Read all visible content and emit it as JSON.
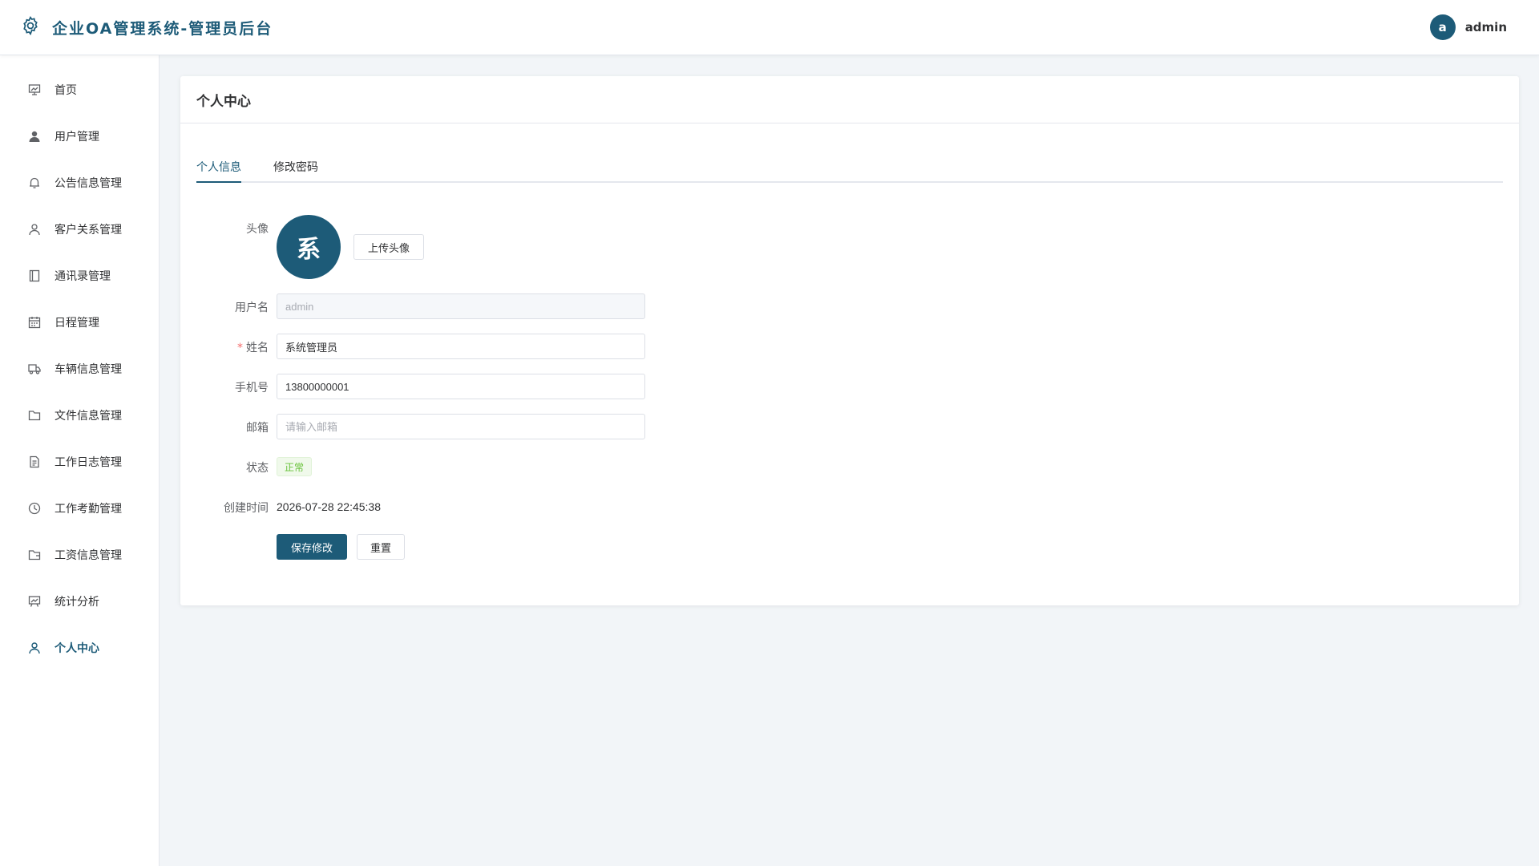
{
  "header": {
    "title": "企业OA管理系统-管理员后台",
    "user_avatar_letter": "a",
    "user_name": "admin"
  },
  "sidebar": {
    "items": [
      {
        "label": "首页",
        "icon": "dashboard-icon"
      },
      {
        "label": "用户管理",
        "icon": "user-filled-icon"
      },
      {
        "label": "公告信息管理",
        "icon": "bell-icon"
      },
      {
        "label": "客户关系管理",
        "icon": "user-icon"
      },
      {
        "label": "通讯录管理",
        "icon": "notebook-icon"
      },
      {
        "label": "日程管理",
        "icon": "calendar-icon"
      },
      {
        "label": "车辆信息管理",
        "icon": "truck-icon"
      },
      {
        "label": "文件信息管理",
        "icon": "folder-icon"
      },
      {
        "label": "工作日志管理",
        "icon": "document-icon"
      },
      {
        "label": "工作考勤管理",
        "icon": "clock-icon"
      },
      {
        "label": "工资信息管理",
        "icon": "wallet-folder-icon"
      },
      {
        "label": "统计分析",
        "icon": "chart-board-icon"
      },
      {
        "label": "个人中心",
        "icon": "user-icon",
        "active": true
      }
    ]
  },
  "card": {
    "title": "个人中心",
    "tabs": [
      {
        "label": "个人信息",
        "active": true
      },
      {
        "label": "修改密码",
        "active": false
      }
    ]
  },
  "form": {
    "avatar_label": "头像",
    "avatar_char": "系",
    "upload_button": "上传头像",
    "username_label": "用户名",
    "username_value": "admin",
    "required_mark": "*",
    "name_label": "姓名",
    "name_value": "系统管理员",
    "phone_label": "手机号",
    "phone_value": "13800000001",
    "email_label": "邮箱",
    "email_placeholder": "请输入邮箱",
    "status_label": "状态",
    "status_value": "正常",
    "created_label": "创建时间",
    "created_value": "2026-07-28 22:45:38",
    "save_button": "保存修改",
    "reset_button": "重置"
  },
  "colors": {
    "primary": "#1d5b78",
    "success": "#67c23a",
    "danger": "#f56c6c"
  }
}
